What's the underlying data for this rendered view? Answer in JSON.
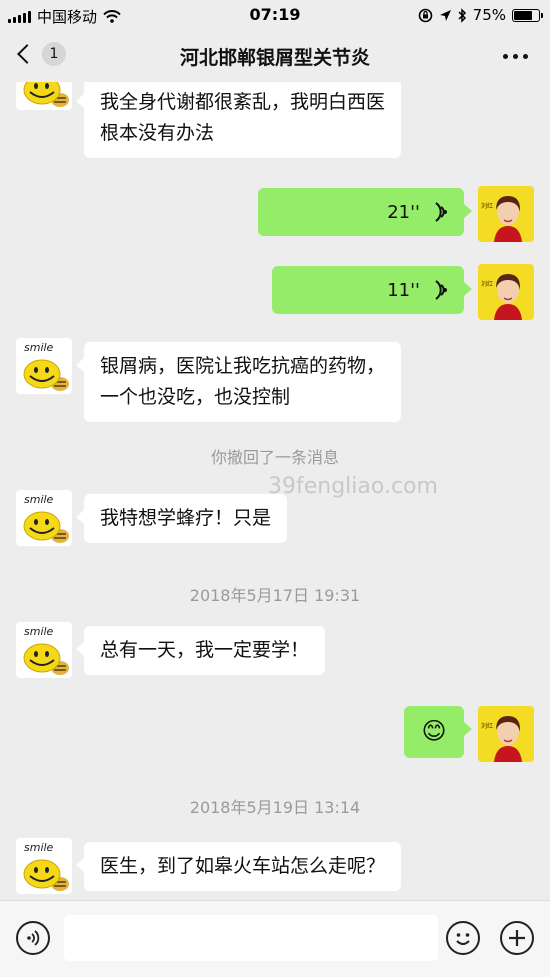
{
  "status_bar": {
    "carrier": "中国移动",
    "time": "07:19",
    "battery": "75%",
    "battery_level": 0.75
  },
  "nav": {
    "unread_count": "1",
    "title": "河北邯郸银屑型关节炎"
  },
  "messages": [
    {
      "side": "in",
      "text_lines": [
        "我全身代谢都很紊乱，我明白西医",
        "根本没有办法"
      ]
    },
    {
      "side": "out",
      "type": "voice",
      "duration": "21''"
    },
    {
      "side": "out",
      "type": "voice",
      "duration": "11''"
    },
    {
      "side": "in",
      "text_lines": [
        "银屑病，医院让我吃抗癌的药物，",
        "一个也没吃，也没控制"
      ]
    },
    {
      "side": "in",
      "text": "我特想学蜂疗！只是"
    },
    {
      "side": "in",
      "text": "总有一天，我一定要学！"
    },
    {
      "side": "out",
      "type": "emoji",
      "emoji": "😊"
    },
    {
      "side": "in",
      "text": "医生，到了如皋火车站怎么走呢？"
    }
  ],
  "system": {
    "recalled": "你撤回了一条消息",
    "watermark": "39fengliao.com",
    "time1": "2018年5月17日 19:31",
    "time2": "2018年5月19日 13:14"
  },
  "avatars": {
    "patient_label": "smile",
    "doctor_label": "刘红"
  },
  "colors": {
    "background": "#ededed",
    "outgoing_bubble": "#95ec69",
    "incoming_bubble": "#ffffff"
  }
}
